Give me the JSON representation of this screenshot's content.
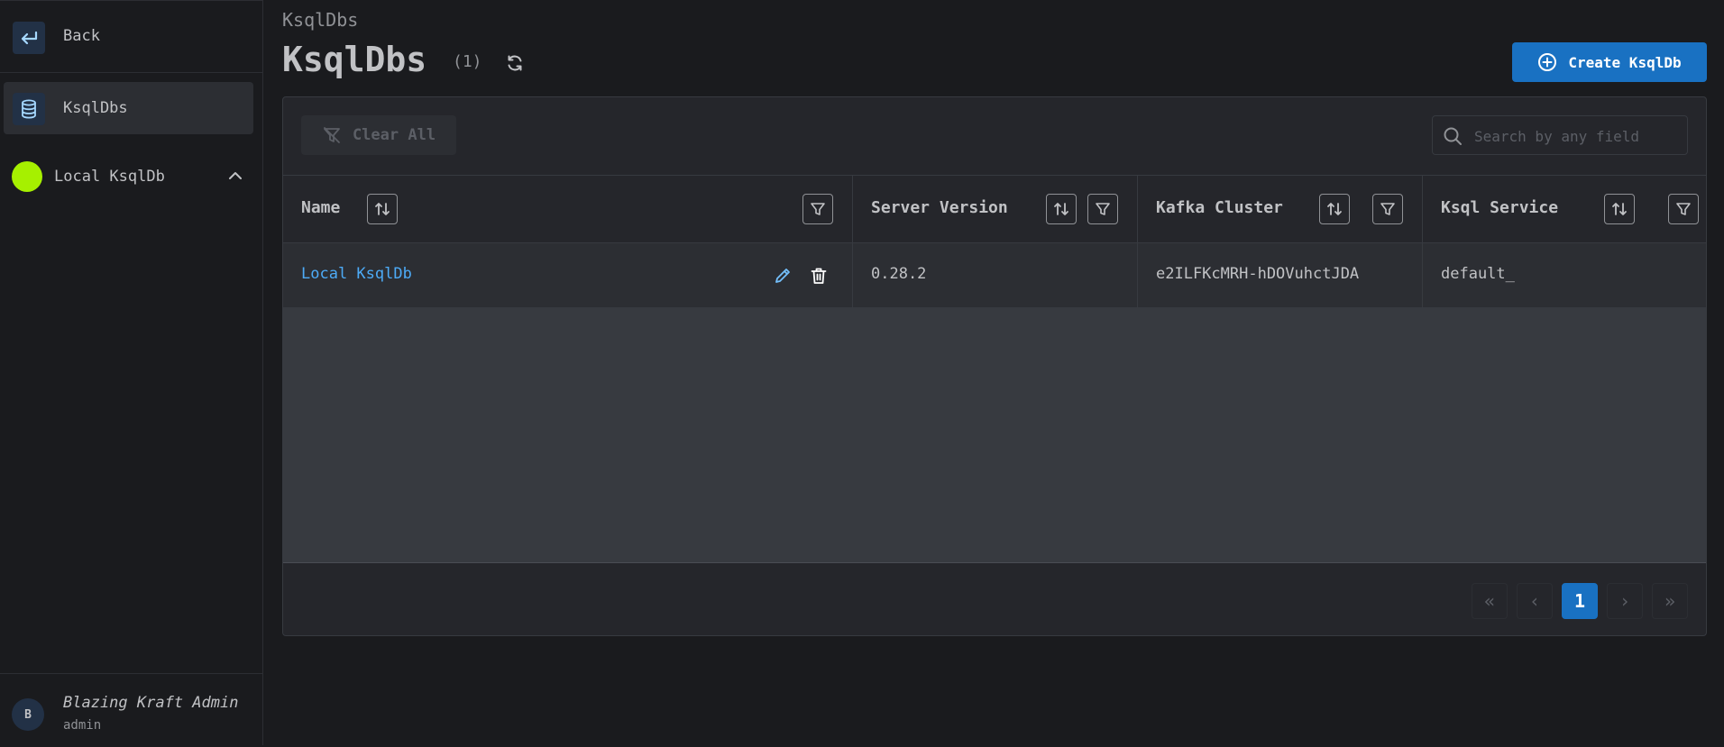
{
  "sidebar": {
    "back_label": "Back",
    "nav_items": [
      {
        "label": "KsqlDbs",
        "icon": "database-icon",
        "active": true
      }
    ],
    "cluster": {
      "label": "Local KsqlDb",
      "color": "#a6f000",
      "expanded": true
    },
    "user": {
      "initial": "B",
      "name": "Blazing Kraft Admin",
      "role": "admin"
    }
  },
  "header": {
    "breadcrumb": "KsqlDbs",
    "title": "KsqlDbs",
    "count": "(1)",
    "create_label": "Create KsqlDb"
  },
  "toolbar": {
    "clear_label": "Clear All",
    "search_placeholder": "Search by any field"
  },
  "table": {
    "columns": [
      "Name",
      "Server Version",
      "Kafka Cluster",
      "Ksql Service"
    ],
    "rows": [
      {
        "name": "Local KsqlDb",
        "server_version": "0.28.2",
        "kafka_cluster": "e2ILFKcMRH-hDOVuhctJDA",
        "ksql_service": "default_"
      }
    ]
  },
  "pagination": {
    "current_page": "1",
    "first": "«",
    "prev": "‹",
    "next": "›",
    "last": "»"
  },
  "colors": {
    "accent": "#1971c2",
    "link": "#4dabf7",
    "background": "#1a1b1e"
  }
}
